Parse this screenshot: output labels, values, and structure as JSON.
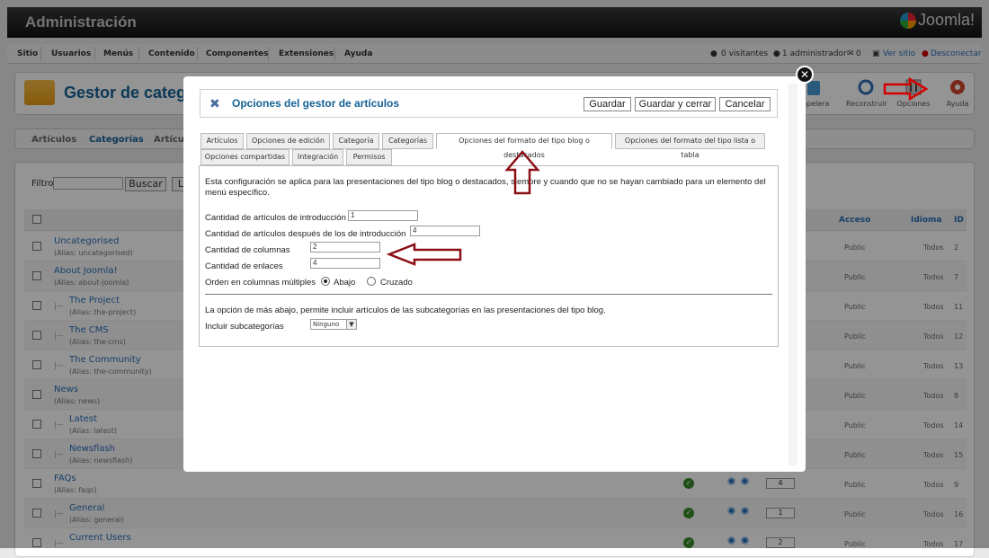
{
  "app": {
    "title": "Administración",
    "logo_text": "Joomla!"
  },
  "menubar": {
    "items": [
      "Sitio",
      "Usuarios",
      "Menús",
      "Contenido",
      "Componentes",
      "Extensiones",
      "Ayuda"
    ],
    "visitors": "0 visitantes",
    "admins": "1 administrador",
    "messages": "0",
    "view_site": "Ver sitio",
    "logout": "Desconectar"
  },
  "header": {
    "title": "Gestor de catego",
    "tools": [
      {
        "label": "Papelera",
        "icon": "trash-icon"
      },
      {
        "label": "Reconstruir",
        "icon": "rebuild-icon"
      },
      {
        "label": "Opciones",
        "icon": "options-icon"
      },
      {
        "label": "Ayuda",
        "icon": "help-icon"
      }
    ]
  },
  "subnav": {
    "items": [
      "Artículos",
      "Categorías",
      "Artícul"
    ]
  },
  "filter": {
    "label": "Filtro:",
    "search_button": "Buscar",
    "clear_button_partial": "L"
  },
  "table": {
    "headers": {
      "access": "Acceso",
      "language": "Idioma",
      "id": "ID"
    },
    "rows": [
      {
        "name": "Uncategorised",
        "alias": "(Alias: uncategorised)",
        "indent": 0,
        "access": "Public",
        "language": "Todos",
        "id": "2"
      },
      {
        "name": "About Joomla!",
        "alias": "(Alias: about-joomla)",
        "indent": 0,
        "access": "Public",
        "language": "Todos",
        "id": "7"
      },
      {
        "name": "The Project",
        "alias": "(Alias: the-project)",
        "indent": 1,
        "access": "Public",
        "language": "Todos",
        "id": "11"
      },
      {
        "name": "The CMS",
        "alias": "(Alias: the-cms)",
        "indent": 1,
        "access": "Public",
        "language": "Todos",
        "id": "12"
      },
      {
        "name": "The Community",
        "alias": "(Alias: the-community)",
        "indent": 1,
        "access": "Public",
        "language": "Todos",
        "id": "13"
      },
      {
        "name": "News",
        "alias": "(Alias: news)",
        "indent": 0,
        "access": "Public",
        "language": "Todos",
        "id": "8"
      },
      {
        "name": "Latest",
        "alias": "(Alias: latest)",
        "indent": 1,
        "access": "Public",
        "language": "Todos",
        "id": "14"
      },
      {
        "name": "Newsflash",
        "alias": "(Alias: newsflash)",
        "indent": 1,
        "access": "Public",
        "language": "Todos",
        "id": "15"
      },
      {
        "name": "FAQs",
        "alias": "(Alias: faqs)",
        "indent": 0,
        "access": "Public",
        "language": "Todos",
        "id": "9",
        "order": "4"
      },
      {
        "name": "General",
        "alias": "(Alias: general)",
        "indent": 1,
        "access": "Public",
        "language": "Todos",
        "id": "16",
        "order": "1"
      },
      {
        "name": "Current Users",
        "alias": "",
        "indent": 1,
        "access": "Public",
        "language": "Todos",
        "id": "17",
        "order": "2"
      }
    ]
  },
  "modal": {
    "title": "Opciones del gestor de artículos",
    "buttons": {
      "save": "Guardar",
      "save_close": "Guardar y cerrar",
      "cancel": "Cancelar"
    },
    "tabs_row1": [
      "Artículos",
      "Opciones de edición",
      "Categoría",
      "Categorías",
      "Opciones del formato del tipo blog o destacados",
      "Opciones del formato del tipo lista o tabla"
    ],
    "tabs_row2": [
      "Opciones compartidas",
      "Integración",
      "Permisos"
    ],
    "description": "Esta configuración se aplica para las presentaciones del tipo blog o destacados, siempre y cuando que no se hayan cambiado para un elemento del menú específico.",
    "fields": {
      "intro_label": "Cantidad de artículos de introducción",
      "intro_value": "1",
      "after_intro_label": "Cantidad de artículos después de los de introducción",
      "after_intro_value": "4",
      "columns_label": "Cantidad de columnas",
      "columns_value": "2",
      "links_label": "Cantidad de enlaces",
      "links_value": "4",
      "order_label": "Orden en columnas múltiples",
      "order_opt1": "Abajo",
      "order_opt2": "Cruzado",
      "subcat_note": "La opción de más abajo, permite incluir artículos de las subcategorías en las presentaciones del tipo blog.",
      "subcat_label": "Incluir subcategorías",
      "subcat_value": "Ninguno"
    }
  },
  "colors": {
    "accent": "#146295",
    "arrow": "#8b0f14",
    "link": "#2a6fb5"
  }
}
